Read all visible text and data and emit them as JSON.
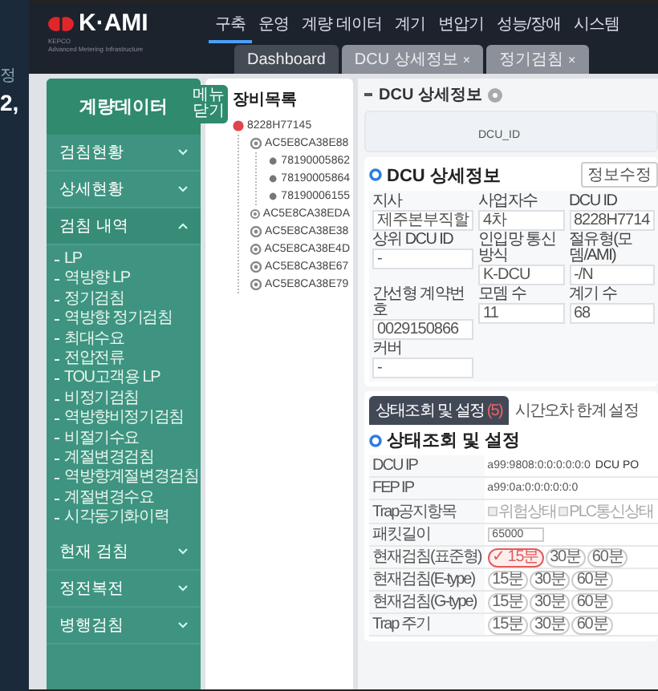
{
  "peek": {
    "label": "정",
    "value": "2,"
  },
  "header": {
    "logo": "K·AMI",
    "logo_sub": "KEPCO",
    "tagline": "Advanced Metering Infrastructure",
    "nav": [
      {
        "label": "구축",
        "selected": true
      },
      {
        "label": "운영",
        "selected": false
      },
      {
        "label": "계량 데이터",
        "selected": false
      },
      {
        "label": "계기",
        "selected": false
      },
      {
        "label": "변압기",
        "selected": false
      },
      {
        "label": "성능/장애",
        "selected": false
      },
      {
        "label": "시스템",
        "selected": false
      }
    ]
  },
  "tabs": [
    {
      "label": "Dashboard",
      "selected": true
    },
    {
      "label": "DCU 상세정보",
      "selected": false,
      "close": "×"
    },
    {
      "label": "정기검침",
      "selected": false,
      "close": "×"
    }
  ],
  "sidebar": {
    "title": "계량데이터",
    "toggle": "메뉴 닫기",
    "items": [
      {
        "label": "검침현황",
        "expanded": false
      },
      {
        "label": "상세현황",
        "expanded": false
      },
      {
        "label": "검침 내역",
        "expanded": true,
        "children": [
          "LP",
          "역방향 LP",
          "정기검침",
          "역방향 정기검침",
          "최대수요",
          "전압전류",
          "TOU고객용 LP",
          "비정기검침",
          "역방향비정기검침",
          "비절기수요",
          "계절변경검침",
          "역방향계절변경검침",
          "계절변경수요",
          "시각동기화이력"
        ]
      },
      {
        "label": "현재 검침",
        "expanded": false
      },
      {
        "label": "정전복전",
        "expanded": false
      },
      {
        "label": "병행검침",
        "expanded": false
      }
    ]
  },
  "tree": {
    "title": "장비목록",
    "nodes": [
      {
        "label": "8228H77145",
        "kind": "dcu",
        "children": [
          {
            "label": "AC5E8CA38E88",
            "kind": "modem",
            "children": [
              {
                "label": "78190005862",
                "kind": "meter"
              },
              {
                "label": "78190005864",
                "kind": "meter"
              },
              {
                "label": "78190006155",
                "kind": "meter"
              }
            ]
          },
          {
            "label": "AC5E8CA38EDA",
            "kind": "modem"
          },
          {
            "label": "AC5E8CA38E38",
            "kind": "modem"
          },
          {
            "label": "AC5E8CA38E4D",
            "kind": "modem"
          },
          {
            "label": "AC5E8CA38E67",
            "kind": "modem"
          },
          {
            "label": "AC5E8CA38E79",
            "kind": "modem"
          }
        ]
      }
    ]
  },
  "main": {
    "page_title": "DCU 상세정보",
    "search_label": "DCU_ID",
    "detail": {
      "title": "DCU 상세정보",
      "button": "정보수정",
      "fields": [
        {
          "label": "지사",
          "value": "제주본부직할"
        },
        {
          "label": "사업자수",
          "value": "4차"
        },
        {
          "label": "DCU ID",
          "value": "8228H7714"
        },
        {
          "label": "상위 DCU ID",
          "value": "-"
        },
        {
          "label": "인입망 통신방식",
          "value": "K-DCU"
        },
        {
          "label": "절유형(모뎀/AMI)",
          "value": "-/N"
        },
        {
          "label": "간선형 계약번호",
          "value": "0029150866"
        },
        {
          "label": "모뎀 수",
          "value": "11"
        },
        {
          "label": "계기 수",
          "value": "68"
        },
        {
          "label": "커버",
          "value": "-"
        }
      ]
    },
    "tabs": [
      {
        "label": "상태조회 및 설정",
        "count": "(5)",
        "selected": true
      },
      {
        "label": "시간오차 한계 설정",
        "selected": false
      }
    ],
    "status": {
      "title": "상태조회 및 설정",
      "rows": [
        {
          "label": "DCU IP",
          "kind": "text",
          "value": "a99:9808:0:0:0:0:0:0",
          "extra": "DCU PO"
        },
        {
          "label": "FEP IP",
          "kind": "text",
          "value": "a99:0a:0:0:0:0:0:0"
        },
        {
          "label": "Trap공지항목",
          "kind": "checks",
          "options": [
            {
              "label": "위험상태",
              "checked": false
            },
            {
              "label": "PLC통신상태",
              "checked": false
            }
          ]
        },
        {
          "label": "패킷길이",
          "kind": "input",
          "value": "65000"
        },
        {
          "label": "현재검침(표준형)",
          "kind": "pills",
          "options": [
            {
              "label": "✓ 15분",
              "selected": true
            },
            {
              "label": "30분",
              "selected": false
            },
            {
              "label": "60분",
              "selected": false
            }
          ]
        },
        {
          "label": "현재검침(E-type)",
          "kind": "pills",
          "options": [
            {
              "label": "15분",
              "selected": false
            },
            {
              "label": "30분",
              "selected": false
            },
            {
              "label": "60분",
              "selected": false
            }
          ]
        },
        {
          "label": "현재검침(G-type)",
          "kind": "pills",
          "options": [
            {
              "label": "15분",
              "selected": false
            },
            {
              "label": "30분",
              "selected": false
            },
            {
              "label": "60분",
              "selected": false
            }
          ]
        },
        {
          "label": "Trap 주기",
          "kind": "pills",
          "options": [
            {
              "label": "15분",
              "selected": false
            },
            {
              "label": "30분",
              "selected": false
            },
            {
              "label": "60분",
              "selected": false
            }
          ]
        }
      ]
    }
  }
}
